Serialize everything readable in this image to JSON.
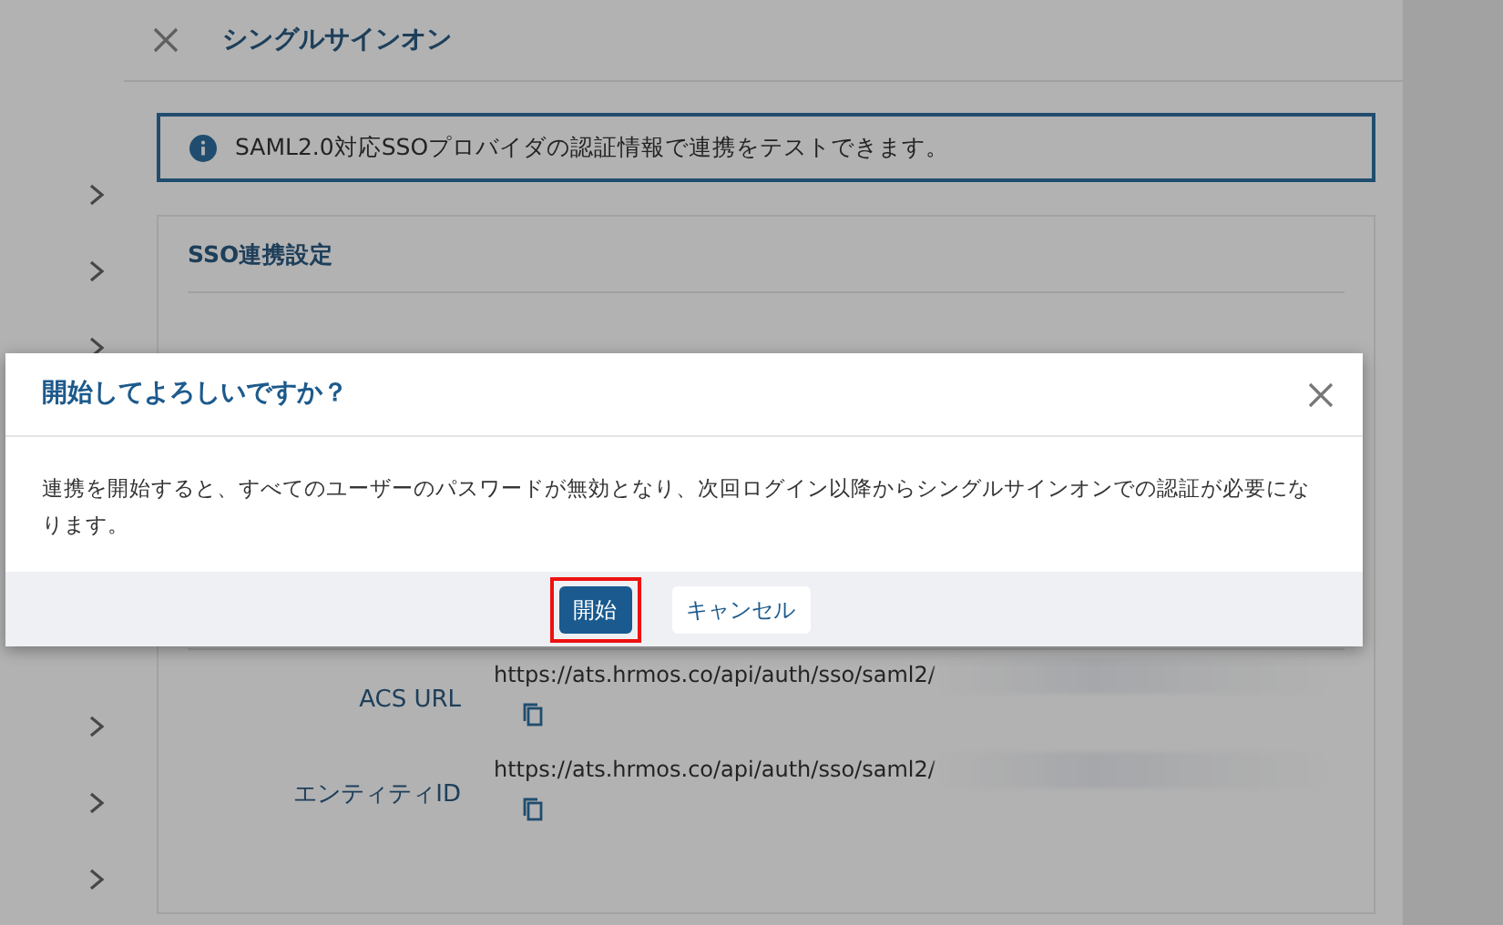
{
  "panel": {
    "title": "シングルサインオン",
    "info": "SAML2.0対応SSOプロバイダの認証情報で連携をテストできます。",
    "section_title": "SSO連携設定",
    "fields": [
      {
        "label": "ACS URL",
        "value": "https://ats.hrmos.co/api/auth/sso/saml2/"
      },
      {
        "label": "エンティティID",
        "value": "https://ats.hrmos.co/api/auth/sso/saml2/"
      }
    ]
  },
  "dialog": {
    "title": "開始してよろしいですか？",
    "message": "連携を開始すると、すべてのユーザーのパスワードが無効となり、次回ログイン以降からシングルサインオンでの認証が必要になります。",
    "buttons": [
      {
        "label": "開始",
        "kind": "primary",
        "focused": true
      },
      {
        "label": "キャンセル",
        "kind": "secondary",
        "focused": false
      }
    ]
  }
}
